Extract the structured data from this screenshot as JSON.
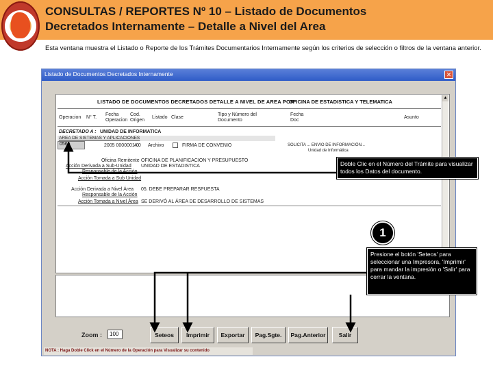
{
  "header": {
    "title_line1": "CONSULTAS / REPORTES Nº 10 – Listado de Documentos",
    "title_line2": "Decretados Internamente – Detalle a Nivel del Area",
    "intro": "Esta ventana muestra el Listado o Reporte de los Trámites Documentarios Internamente según los criterios de selección o filtros de la ventana anterior.",
    "colors": {
      "header_bg": "#f6a34a",
      "logo": "#c0392b"
    }
  },
  "window": {
    "title": "Listado de Documentos Decretados Internamente",
    "close_icon": "close-icon",
    "report_title": "LISTADO DE DOCUMENTOS DECRETADOS   DETALLE A NIVEL DE AREA POR :",
    "report_area": "OFICINA DE ESTADISTICA Y TELEMATICA",
    "columns": [
      "Operacion",
      "N° T.",
      "Fecha Operacion",
      "Cod. Origen",
      "Listado",
      "Clase",
      "Tipo y Número del Documento",
      "Fecha Doc",
      "Asunto"
    ],
    "decretado_label": "DECRETADO A :",
    "decretado_value": "UNIDAD DE INFORMATICA",
    "subarea": "AREA DE SISTEMAS Y APLICACIONES",
    "row_num": "0565",
    "row_code": "2005 0000001 0",
    "row_code2": "4.0",
    "row_archivo": "Archivo",
    "row_detail": "FIRMA DE CONVENIO",
    "row_right1": "SOLICITA ...  ENVIO DE INFORMACIÓN...",
    "row_right2": "Unidad de Informática",
    "fields": [
      {
        "label": "Oficina Remitente",
        "value": "OFICINA DE PLANIFICACION Y PRESUPUESTO"
      },
      {
        "label": "Acción Derivada a Sub-Unidad",
        "value": "UNIDAD DE ESTADISTICA"
      },
      {
        "label": "Responsable de la Acción",
        "value": ""
      },
      {
        "label": "Acción Tomada a Sub Unidad",
        "value": ""
      },
      {
        "label": "Acción Derivada a Nivel Área",
        "value": "05. DEBE PREPARAR RESPUESTA"
      },
      {
        "label": "Responsable de la Acción",
        "value": ""
      },
      {
        "label": "Acción Tomada a Nivel Área",
        "value": "SE DERIVÓ AL ÁREA DE DESARROLLO DE SISTEMAS"
      }
    ],
    "zoom_label": "Zoom :",
    "zoom_value": "100",
    "buttons": [
      "Seteos",
      "Imprimir",
      "Exportar",
      "Pag.Sgte.",
      "Pag.Anterior",
      "Salir"
    ],
    "nota": "NOTA : Haga Doble Click en el Número de la Operación para Visualizar su contenido"
  },
  "callouts": {
    "top": "Doble Clic en el Número del Trámite para visualizar todos los Datos del documento.",
    "step": "1",
    "bottom": "Presione el botón 'Seteos' para seleccionar una Impresora, 'Imprimir' para mandar la impresión o 'Salir' para cerrar la ventana."
  }
}
